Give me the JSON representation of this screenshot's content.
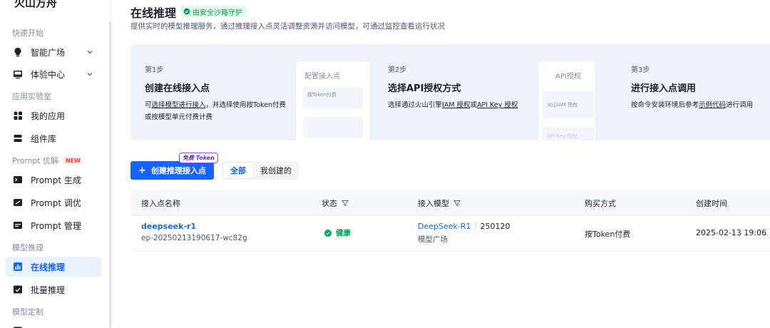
{
  "sidebar": {
    "brand": "火山方舟",
    "sections": [
      "快速开始",
      "应用实验室",
      "Prompt 优解",
      "模型推理",
      "模型定制"
    ],
    "new_badge": "NEW",
    "items": [
      {
        "label": "智能广场",
        "icon": "bulb-icon"
      },
      {
        "label": "体验中心",
        "icon": "monitor-icon"
      },
      {
        "label": "我的应用",
        "icon": "apps-icon"
      },
      {
        "label": "组件库",
        "icon": "stack-icon"
      },
      {
        "label": "Prompt 生成",
        "icon": "prompt-generate-icon"
      },
      {
        "label": "Prompt 调优",
        "icon": "prompt-tune-icon"
      },
      {
        "label": "Prompt 管理",
        "icon": "prompt-manage-icon"
      },
      {
        "label": "在线推理",
        "icon": "bar-chart-icon"
      },
      {
        "label": "批量推理",
        "icon": "batch-icon"
      }
    ]
  },
  "header": {
    "title": "在线推理",
    "safe_badge": "由安全沙箱守护",
    "subtitle": "提供实时的模型推理服务，通过推理接入点灵活调整资源并访问模型，可通过监控查看运行状况"
  },
  "steps": [
    {
      "label": "第1步",
      "title": "创建在线接入点",
      "desc_line1_pre": "可",
      "desc_line1_link": "选择模型进行接入",
      "desc_line1_post": "，并选择使用按Token付费",
      "desc_line2": "或按模型单元付费计费",
      "mock_head": "配置接入点",
      "mock_chip": "按Token付费"
    },
    {
      "label": "第2步",
      "title": "选择API授权方式",
      "desc_pre": "选择通过火山引擎",
      "desc_link1": "IAM 授权",
      "desc_mid": "或",
      "desc_link2": "API Key 授权",
      "mock_head": "API授权",
      "mock_chip1": "火山IAM 授权",
      "mock_chip2": "API Key 授权"
    },
    {
      "label": "第3步",
      "title": "进行接入点调用",
      "desc_pre": "按命令安装环境后参考",
      "desc_link": "示例代码",
      "desc_post": "进行调用"
    }
  ],
  "toolbar": {
    "create_label": "创建推理接入点",
    "free_badge": "免费 Token",
    "tab_all": "全部",
    "tab_mine": "我创建的"
  },
  "table": {
    "headers": {
      "name": "接入点名称",
      "status": "状态",
      "model": "接入模型",
      "billing": "购买方式",
      "created": "创建时间"
    },
    "rows": [
      {
        "name": "deepseek-r1",
        "id": "ep-20250213190617-wc82g",
        "status": "健康",
        "model": "DeepSeek-R1",
        "version": "250120",
        "model_source": "模型广场",
        "billing": "按Token付费",
        "created": "2025-02-13 19:06"
      }
    ]
  },
  "colors": {
    "accent": "#1664ff",
    "success": "#00a35a",
    "banner_bg": "#eef3fc"
  }
}
